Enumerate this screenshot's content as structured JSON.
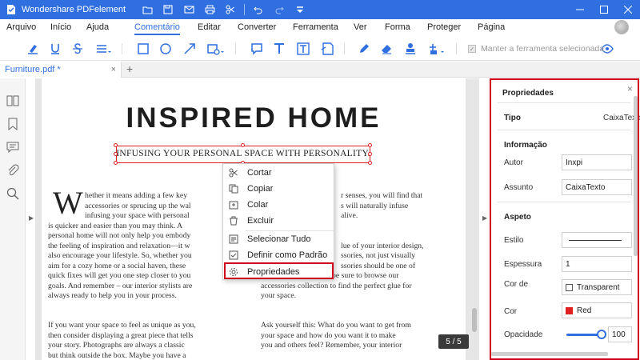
{
  "app": {
    "title": "Wondershare PDFelement",
    "accent_color": "#2f6fe0",
    "highlight_color": "#d0021b"
  },
  "menu": {
    "items": [
      "Arquivo",
      "Início",
      "Ajuda",
      "Comentário",
      "Editar",
      "Converter",
      "Ferramenta",
      "Ver",
      "Forma",
      "Proteger",
      "Página"
    ],
    "active": "Comentário"
  },
  "toolbar": {
    "tools": [
      "highlight-icon",
      "underline-icon",
      "strikethrough-icon",
      "insert-text-icon",
      "rectangle-icon",
      "oval-icon",
      "arrow-icon",
      "shape-icon",
      "note-icon",
      "typewriter-icon",
      "text-box-icon",
      "callout-icon",
      "pencil-icon",
      "eraser-icon",
      "stamp-icon",
      "attachment-icon"
    ],
    "keep_tool_selected": "Manter a ferramenta selecionada"
  },
  "tab": {
    "name": "Furniture.pdf *",
    "close": "×",
    "add": "+"
  },
  "document": {
    "headline": "INSPIRED HOME",
    "subhead": "INFUSING YOUR PERSONAL SPACE WITH PERSONALITY.",
    "dropcap": "W",
    "col1_lines": [
      "hether it means adding a few key",
      "accessories or sprucing up the wal",
      "infusing your space with personal",
      "is quicker and easier than you may think. A",
      "personal home will not only help you embody",
      "the feeling of inspiration and relaxation—it w",
      "also encourage your lifestyle. So, whether you",
      "aim for a cozy home or a social haven, these",
      "quick fixes will get you one step closer to you",
      "goals. And remember – our interior stylists are",
      "always ready to help you in your process."
    ],
    "col1b_lines": [
      "If you want your space to feel as unique as you,",
      "then consider displaying a great piece that tells",
      "your story. Photographs are always a classic",
      "but think outside the box. Maybe you have a"
    ],
    "col2_lines": [
      "r senses, you will find that",
      "s will naturally infuse",
      "alive.",
      "",
      "",
      "lue of your interior design,",
      "ssories, not just visually",
      "ssories should be one of",
      "your greatest allies, so be sure to browse our",
      "accessories collection to find the perfect glue for",
      "your space."
    ],
    "col2b_lines": [
      "Ask yourself this: What do you want to get from",
      "your space and how do you want it to make",
      "you and others feel? Remember, your interior"
    ],
    "page_indicator": "5 / 5"
  },
  "context_menu": {
    "items": [
      {
        "label": "Cortar",
        "icon": "cut-icon"
      },
      {
        "label": "Copiar",
        "icon": "copy-icon"
      },
      {
        "label": "Colar",
        "icon": "paste-icon"
      },
      {
        "label": "Excluir",
        "icon": "delete-icon"
      },
      {
        "label": "Selecionar Tudo",
        "icon": "select-all-icon"
      },
      {
        "label": "Definir como Padrão",
        "icon": "check-icon"
      },
      {
        "label": "Propriedades",
        "icon": "settings-icon"
      }
    ],
    "highlighted": "Propriedades"
  },
  "properties": {
    "title": "Propriedades",
    "close": "×",
    "type_label": "Tipo",
    "type_value": "CaixaTexto",
    "info_header": "Informação",
    "author_label": "Autor",
    "author_value": "Inxpi",
    "subject_label": "Assunto",
    "subject_value": "CaixaTexto",
    "appearance_header": "Aspeto",
    "style_label": "Estilo",
    "thickness_label": "Espessura",
    "thickness_value": "1",
    "fill_label": "Cor de",
    "fill_value": "Transparent",
    "color_label": "Cor",
    "color_value": "Red",
    "color_hex": "#e02020",
    "opacity_label": "Opacidade",
    "opacity_value": "100"
  }
}
